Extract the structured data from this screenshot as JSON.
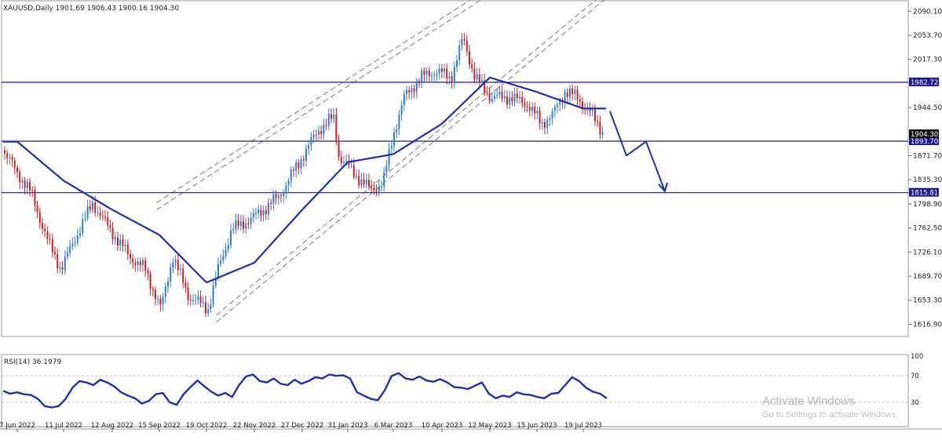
{
  "header": {
    "symbol_line": "XAUUSD,Daily  1901.69 1906.43 1900.16 1904.30"
  },
  "rsi_panel": {
    "label": "RSI(14) 36.1979"
  },
  "watermark": {
    "title": "Activate Windows",
    "subtitle": "Go to Settings to activate Windows."
  },
  "colors": {
    "bull": "#2a7fd6",
    "bear": "#d02020",
    "ma": "#1e2fb3",
    "level_line": "#1a1a9e",
    "level_label_bg": "#1a1a9e",
    "channel": "#707070",
    "arrow": "#1e2fb3"
  },
  "chart_data": [
    {
      "type": "candlestick",
      "title": "XAUUSD,Daily  1901.69 1906.43 1900.16 1904.30",
      "symbol": "XAUUSD",
      "timeframe": "Daily",
      "last_bar": {
        "open": 1901.69,
        "high": 1906.43,
        "low": 1900.16,
        "close": 1904.3
      },
      "x_tick_labels": [
        "7 Jun 2022",
        "11 Jul 2022",
        "12 Aug 2022",
        "15 Sep 2022",
        "19 Oct 2022",
        "22 Nov 2022",
        "27 Dec 2022",
        "31 Jan 2023",
        "6 Mar 2023",
        "10 Apr 2023",
        "12 May 2023",
        "15 Jun 2023",
        "19 Jul 2023"
      ],
      "y_tick_labels": [
        "2090.10",
        "2053.70",
        "2017.30",
        "1944.50",
        "1871.70",
        "1835.30",
        "1798.90",
        "1762.50",
        "1726.10",
        "1689.70",
        "1653.30",
        "1616.90"
      ],
      "ylim": [
        1602,
        2100
      ],
      "horizontal_levels": [
        {
          "value": 1982.72,
          "label": "1982.72"
        },
        {
          "value": 1893.7,
          "label": "1893.70"
        },
        {
          "value": 1815.81,
          "label": "1815.81"
        }
      ],
      "current_price_label": "1904.30",
      "moving_average_path": [
        [
          "7 Jun 2022",
          1893
        ],
        [
          "11 Jul 2022",
          1834
        ],
        [
          "12 Aug 2022",
          1790
        ],
        [
          "15 Sep 2022",
          1752
        ],
        [
          "19 Oct 2022",
          1680
        ],
        [
          "22 Nov 2022",
          1710
        ],
        [
          "27 Dec 2022",
          1790
        ],
        [
          "31 Jan 2023",
          1862
        ],
        [
          "6 Mar 2023",
          1874
        ],
        [
          "10 Apr 2023",
          1920
        ],
        [
          "12 May 2023",
          1990
        ],
        [
          "15 Jun 2023",
          1968
        ],
        [
          "19 Jul 2023",
          1943
        ]
      ],
      "upper_channel": [
        [
          "13 Sep 2022",
          1790
        ],
        [
          "8 May 2023",
          2110
        ]
      ],
      "lower_channel": [
        [
          "26 Oct 2022",
          1620
        ],
        [
          "5 Aug 2023",
          2110
        ]
      ],
      "projection_path": [
        1939,
        1872,
        1893,
        1818
      ]
    },
    {
      "type": "line",
      "title": "RSI(14) 36.1979",
      "indicator": "RSI",
      "period": 14,
      "last_value": 36.1979,
      "ylim": [
        0,
        100
      ],
      "y_tick_labels": [
        "100",
        "70",
        "30"
      ],
      "levels": [
        70,
        30
      ],
      "values": [
        47,
        43,
        45,
        42,
        41,
        35,
        24,
        22,
        24,
        35,
        52,
        62,
        60,
        56,
        64,
        60,
        54,
        45,
        40,
        36,
        28,
        32,
        42,
        44,
        30,
        26,
        42,
        53,
        63,
        54,
        46,
        40,
        44,
        38,
        56,
        69,
        72,
        62,
        60,
        66,
        58,
        56,
        64,
        58,
        62,
        68,
        66,
        72,
        70,
        71,
        66,
        45,
        40,
        35,
        33,
        48,
        70,
        74,
        66,
        64,
        69,
        63,
        61,
        65,
        60,
        53,
        52,
        50,
        55,
        60,
        43,
        36,
        40,
        38,
        45,
        42,
        41,
        38,
        36,
        43,
        44,
        56,
        68,
        62,
        52,
        46,
        43,
        36
      ]
    }
  ]
}
